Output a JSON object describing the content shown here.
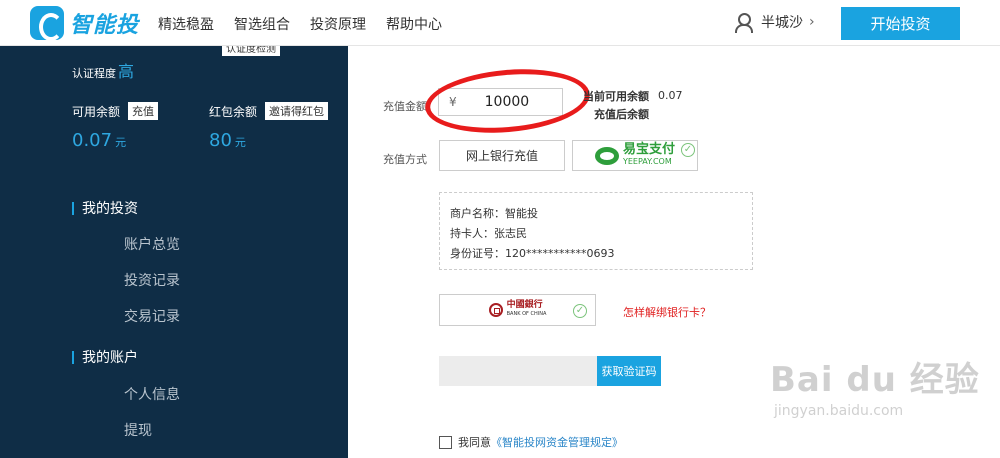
{
  "header": {
    "logo_text": "智能投",
    "nav": [
      "精选稳盈",
      "智选组合",
      "投资原理",
      "帮助中心"
    ],
    "username": "半城沙",
    "user_chevron": "›",
    "start_button": "开始投资"
  },
  "sidebar": {
    "cert_tag": "认证度检测",
    "cert_label": "认证程度",
    "cert_level": "高",
    "available_label": "可用余额",
    "recharge_chip": "充值",
    "available_value": "0.07",
    "redpack_label": "红包余额",
    "invite_chip": "邀请得红包",
    "redpack_value": "80",
    "unit": "元",
    "sections": [
      {
        "title": "我的投资",
        "items": [
          "账户总览",
          "投资记录",
          "交易记录"
        ]
      },
      {
        "title": "我的账户",
        "items": [
          "个人信息",
          "提现"
        ]
      }
    ]
  },
  "form": {
    "amount_label": "充值金额",
    "currency_symbol": "¥",
    "amount_value": "10000",
    "current_balance_label": "当前可用余额",
    "current_balance_value": "0.07",
    "after_balance_label": "充值后余额",
    "method_label": "充值方式",
    "method_bank": "网上银行充值",
    "yeepay_cn": "易宝支付",
    "yeepay_en": "YEEPAY.COM",
    "merchant_line": "商户名称：智能投",
    "holder_line": "持卡人：张志民",
    "id_line": "身份证号：120***********0693",
    "boc_cn": "中國銀行",
    "boc_en": "BANK OF CHINA",
    "unbind_link": "怎样解绑银行卡？",
    "code_button": "获取验证码",
    "agree_text": "我同意",
    "agree_link": "《智能投网资金管理规定》"
  },
  "watermark": {
    "main": "Bai du 经验",
    "sub": "jingyan.baidu.com"
  },
  "colors": {
    "brand": "#1aa3e0",
    "sidebar_bg": "#0f2d46",
    "highlight_red": "#e81c1c",
    "yeepay_green": "#2e9e3b"
  }
}
